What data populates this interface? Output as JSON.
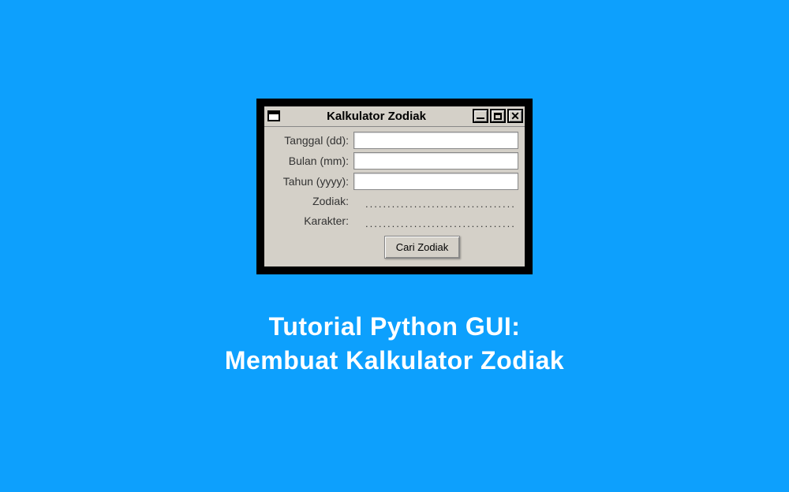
{
  "window": {
    "title": "Kalkulator Zodiak"
  },
  "form": {
    "labels": {
      "tanggal": "Tanggal (dd):",
      "bulan": "Bulan (mm):",
      "tahun": "Tahun (yyyy):",
      "zodiak": "Zodiak:",
      "karakter": "Karakter:"
    },
    "values": {
      "tanggal": "",
      "bulan": "",
      "tahun": "",
      "zodiak": "..................................",
      "karakter": ".................................."
    },
    "button": "Cari Zodiak"
  },
  "caption": {
    "line1": "Tutorial Python GUI:",
    "line2": "Membuat Kalkulator Zodiak"
  }
}
